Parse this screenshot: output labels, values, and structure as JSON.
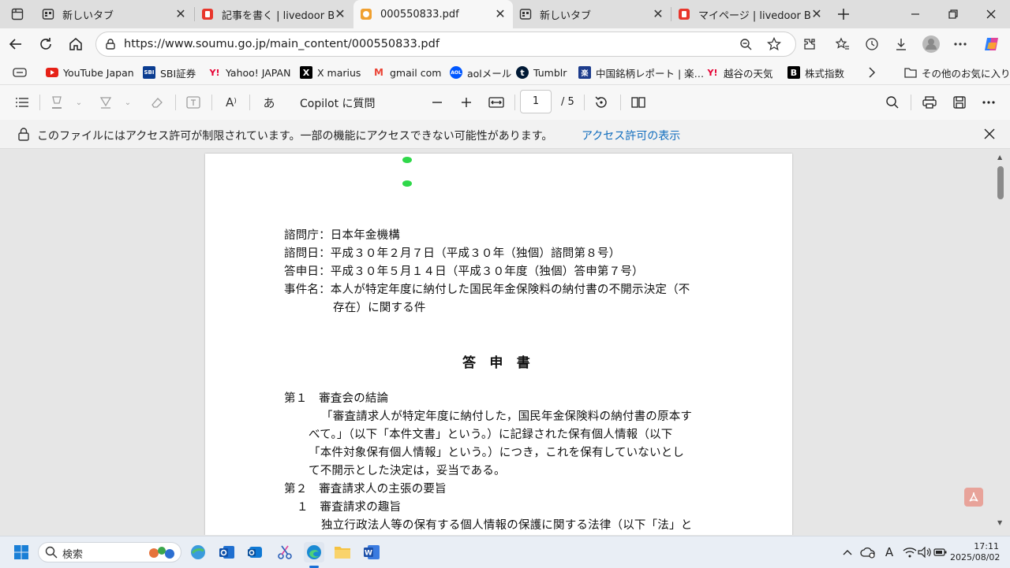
{
  "tabs": [
    {
      "title": "新しいタブ",
      "active": false
    },
    {
      "title": "記事を書く | livedoor Blog",
      "active": false
    },
    {
      "title": "000550833.pdf",
      "active": true
    },
    {
      "title": "新しいタブ",
      "active": false
    },
    {
      "title": "マイページ | livedoor Blog",
      "active": false
    }
  ],
  "address": {
    "url": "https://www.soumu.go.jp/main_content/000550833.pdf"
  },
  "bookmarks": [
    {
      "label": "YouTube Japan",
      "icon": "youtube-icon",
      "color": "#e62117"
    },
    {
      "label": "SBI証券",
      "icon": "sbi-icon",
      "badge": "SBI",
      "color": "#0b3d91"
    },
    {
      "label": "Yahoo! JAPAN",
      "icon": "yahoo-icon",
      "badge": "Y!",
      "color": "#e60033"
    },
    {
      "label": "X marius",
      "icon": "x-icon",
      "badge": "X",
      "color": "#000000"
    },
    {
      "label": "gmail com",
      "icon": "gmail-icon",
      "badge": "M",
      "color": "#ea4335"
    },
    {
      "label": "aolメール",
      "icon": "aol-icon",
      "badge": "AOL",
      "color": "#0057ff"
    },
    {
      "label": "Tumblr",
      "icon": "tumblr-icon",
      "badge": "t",
      "color": "#001935"
    },
    {
      "label": "中国銘柄レポート | 楽…",
      "icon": "rakuten-icon",
      "badge": "楽",
      "color": "#1d3c8c"
    },
    {
      "label": "越谷の天気",
      "icon": "yahoo-weather-icon",
      "badge": "Y!",
      "color": "#e60033"
    },
    {
      "label": "株式指数",
      "icon": "b-icon",
      "badge": "B",
      "color": "#000000"
    }
  ],
  "other_bookmarks": "その他のお気に入り",
  "pdf_toolbar": {
    "copilot": "Copilot に質問",
    "page_value": "1",
    "page_total": "/ 5",
    "read_aloud_glyph": "A⁾",
    "translate_glyph": "あ"
  },
  "notice": {
    "message": "このファイルにはアクセス許可が制限されています。一部の機能にアクセスできない可能性があります。",
    "link": "アクセス許可の表示"
  },
  "document": {
    "header_lines": [
      "諮問庁：日本年金機構",
      "諮問日：平成３０年２月７日（平成３０年（独個）諮問第８号）",
      "答申日：平成３０年５月１４日（平成３０年度（独個）答申第７号）",
      "事件名：本人が特定年度に納付した国民年金保険料の納付書の不開示決定（不",
      "存在）に関する件"
    ],
    "title": "答　申　書",
    "section1_heading": "第１　審査会の結論",
    "section1_lines": [
      "「審査請求人が特定年度に納付した，国民年金保険料の納付書の原本す",
      "べて。」（以下「本件文書」という。）に記録された保有個人情報（以下",
      "「本件対象保有個人情報」という。）につき，これを保有していないとし",
      "て不開示とした決定は，妥当である。"
    ],
    "section2_heading": "第２　審査請求人の主張の要旨",
    "sub1_heading": "１　審査請求の趣旨",
    "sub1_line": "独立行政法人等の保有する個人情報の保護に関する法律（以下「法」と"
  },
  "taskbar": {
    "search_placeholder": "検索",
    "ime": "A",
    "time": "17:11",
    "date": "2025/08/02"
  }
}
